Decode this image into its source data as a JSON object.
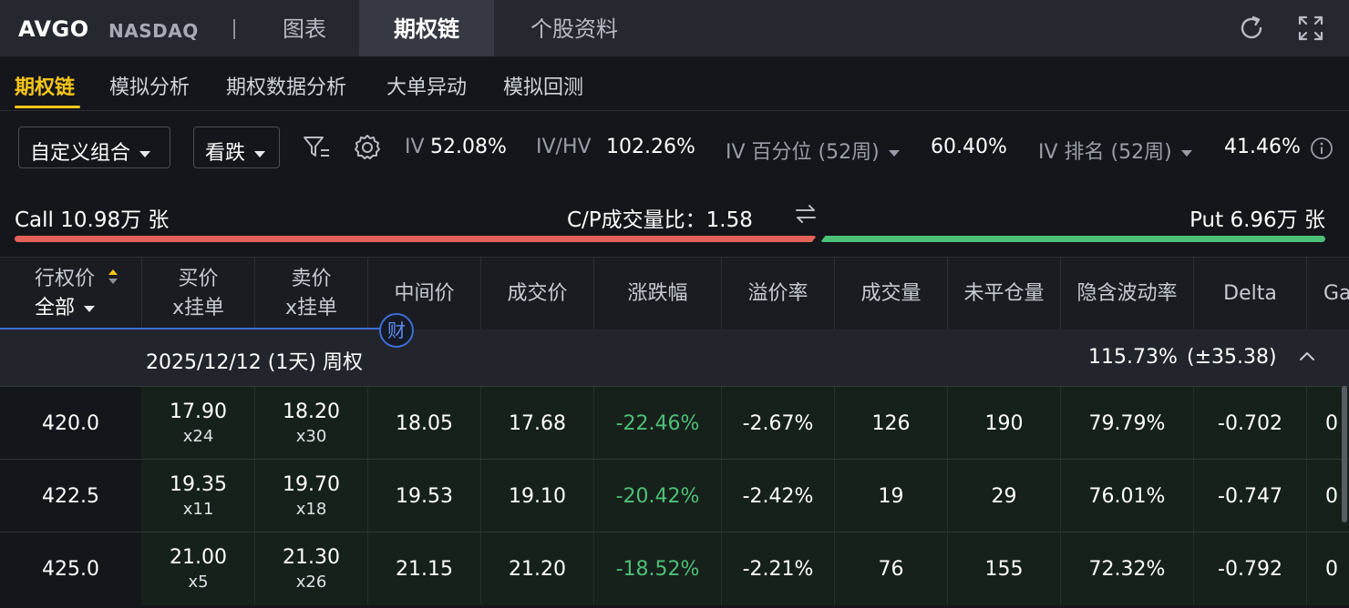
{
  "header": {
    "ticker": "AVGO",
    "exchange": "NASDAQ",
    "tabs": [
      {
        "label": "图表",
        "active": false
      },
      {
        "label": "期权链",
        "active": true
      },
      {
        "label": "个股资料",
        "active": false
      }
    ],
    "icons": [
      "refresh-icon",
      "expand-icon"
    ]
  },
  "subtabs": [
    {
      "label": "期权链",
      "active": true
    },
    {
      "label": "模拟分析",
      "active": false
    },
    {
      "label": "期权数据分析",
      "active": false
    },
    {
      "label": "大单异动",
      "active": false
    },
    {
      "label": "模拟回测",
      "active": false
    }
  ],
  "controls": {
    "strategy_select": "自定义组合",
    "direction_select": "看跌",
    "iv_label": "IV",
    "iv_value": "52.08%",
    "ivhv_label": "IV/HV",
    "ivhv_value": "102.26%",
    "iv_pct_label": "IV 百分位 (52周)",
    "iv_pct_value": "60.40%",
    "iv_rank_label": "IV 排名 (52周)",
    "iv_rank_value": "41.46%"
  },
  "volume": {
    "call_text": "Call 10.98万 张",
    "ratio_text": "C/P成交量比：1.58",
    "put_text": "Put 6.96万 张",
    "call_fraction": 0.612,
    "colors": {
      "call": "#e3625a",
      "put": "#4dc078"
    }
  },
  "table": {
    "headers": {
      "strike": "行权价",
      "strike_filter": "全部",
      "bid": "买价",
      "bid_sub": "x挂单",
      "ask": "卖价",
      "ask_sub": "x挂单",
      "mid": "中间价",
      "last": "成交价",
      "change": "涨跌幅",
      "premium": "溢价率",
      "volume": "成交量",
      "oi": "未平仓量",
      "iv": "隐含波动率",
      "delta": "Delta",
      "gamma_partial": "Ga"
    },
    "fin_badge": "财",
    "expiry": {
      "label": "2025/12/12 (1天) 周权",
      "iv": "115.73%",
      "move": "(±35.38)"
    },
    "rows": [
      {
        "strike": "420.0",
        "bid": "17.90",
        "bid_size": "x24",
        "ask": "18.20",
        "ask_size": "x30",
        "mid": "18.05",
        "last": "17.68",
        "change": "-22.46%",
        "premium": "-2.67%",
        "volume": "126",
        "oi": "190",
        "iv": "79.79%",
        "delta": "-0.702",
        "gamma_partial": "0"
      },
      {
        "strike": "422.5",
        "bid": "19.35",
        "bid_size": "x11",
        "ask": "19.70",
        "ask_size": "x18",
        "mid": "19.53",
        "last": "19.10",
        "change": "-20.42%",
        "premium": "-2.42%",
        "volume": "19",
        "oi": "29",
        "iv": "76.01%",
        "delta": "-0.747",
        "gamma_partial": "0"
      },
      {
        "strike": "425.0",
        "bid": "21.00",
        "bid_size": "x5",
        "ask": "21.30",
        "ask_size": "x26",
        "mid": "21.15",
        "last": "21.20",
        "change": "-18.52%",
        "premium": "-2.21%",
        "volume": "76",
        "oi": "155",
        "iv": "72.32%",
        "delta": "-0.792",
        "gamma_partial": "0"
      }
    ]
  }
}
